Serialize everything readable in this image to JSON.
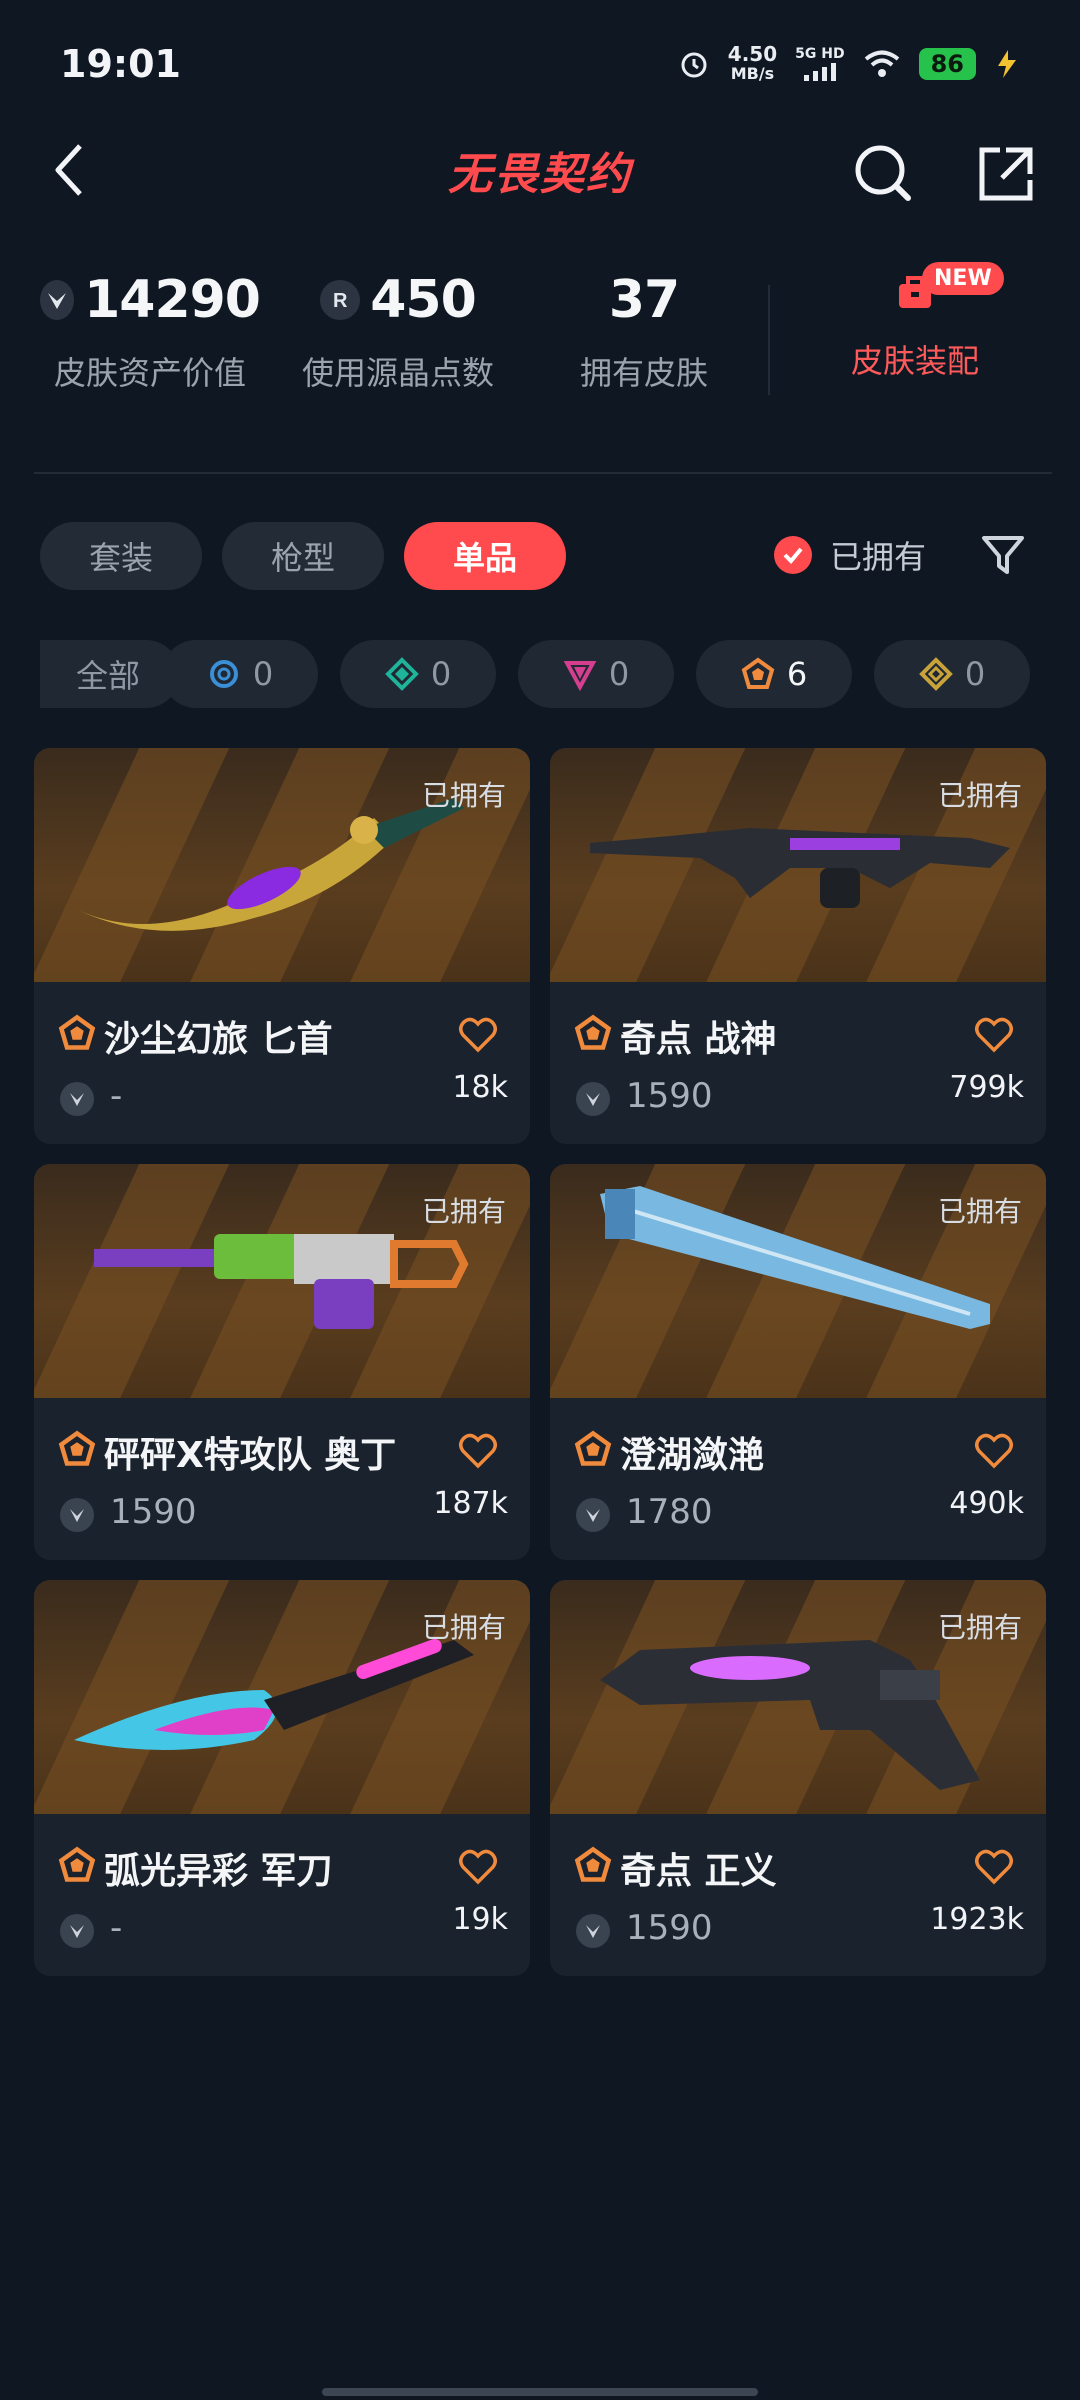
{
  "status": {
    "time": "19:01",
    "speed": "4.50",
    "speed_unit": "MB/s",
    "network": "5G HD",
    "battery": "86"
  },
  "header": {
    "title": "无畏契约",
    "back_icon": "back-icon",
    "search_icon": "search-icon",
    "share_icon": "share-icon"
  },
  "stats": {
    "asset_value": "14290",
    "asset_label": "皮肤资产价值",
    "radianite": "450",
    "radianite_label": "使用源晶点数",
    "owned_count": "37",
    "owned_label": "拥有皮肤",
    "dress_label": "皮肤装配",
    "new_badge": "NEW"
  },
  "tabs": [
    {
      "label": "套装"
    },
    {
      "label": "枪型"
    },
    {
      "label": "单品"
    }
  ],
  "owned_filter": {
    "label": "已拥有",
    "checked": true
  },
  "tiers": [
    {
      "label": "全部"
    },
    {
      "count": "0",
      "color": "#3a8fd6"
    },
    {
      "count": "0",
      "color": "#1fb39a"
    },
    {
      "count": "0",
      "color": "#d63f8f"
    },
    {
      "count": "6",
      "color": "#f08a3c"
    },
    {
      "count": "0",
      "color": "#c9a23a"
    }
  ],
  "cards": [
    {
      "owned": "已拥有",
      "name": "沙尘幻旅 匕首",
      "price": "-",
      "likes": "18k"
    },
    {
      "owned": "已拥有",
      "name": "奇点 战神",
      "price": "1590",
      "likes": "799k"
    },
    {
      "owned": "已拥有",
      "name": "砰砰X特攻队 奥丁",
      "price": "1590",
      "likes": "187k"
    },
    {
      "owned": "已拥有",
      "name": "澄湖潋滟",
      "price": "1780",
      "likes": "490k"
    },
    {
      "owned": "已拥有",
      "name": "弧光异彩 军刀",
      "price": "-",
      "likes": "19k"
    },
    {
      "owned": "已拥有",
      "name": "奇点 正义",
      "price": "1590",
      "likes": "1923k"
    }
  ]
}
